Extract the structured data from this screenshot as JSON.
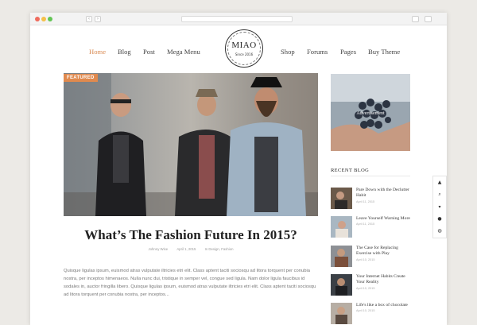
{
  "nav": {
    "home": "Home",
    "blog": "Blog",
    "post": "Post",
    "mega_menu": "Mega Menu",
    "shop": "Shop",
    "forums": "Forums",
    "pages": "Pages",
    "buy_theme": "Buy Theme"
  },
  "logo": {
    "title": "MIAO",
    "since": "Since 2016"
  },
  "featured": {
    "badge": "FEATURED",
    "title": "What’s The Fashion Future In 2015?",
    "meta_author": "Johnny Wise",
    "meta_date": "April 1, 2015",
    "meta_categories": "In Design, Fashion",
    "excerpt": "Quisque ligulas ipsum, euismod atras vulputate iltricies etri elit. Class aptent taciti sociosqu ad litora torquent per conubia nostra, per inceptos himenaeos. Nulla nunc dui, tristique in semper vel, congue sed ligula. Nam dolor ligula faucibus id sodales in, auctor fringilla libero. Quisque ligulas ipsum, euismod atras vulputate iltricies etri elit. Class aptent taciti sociosqu ad litora torquent per conubia nostra, per inceptos..."
  },
  "sidebar": {
    "ad_label": "Advertisement",
    "recent_title": "RECENT BLOG",
    "items": [
      {
        "title": "Pare Down with the Declutter Habit",
        "date": "April 11, 2015"
      },
      {
        "title": "Leave Yourself Warning More",
        "date": "April 11, 2015"
      },
      {
        "title": "The Case for Replacing Exercise with Play",
        "date": "April 10, 2015"
      },
      {
        "title": "Your Internet Habits Create Your Reality",
        "date": "April 10, 2015"
      },
      {
        "title": "Life's like a box of chocolate",
        "date": "April 10, 2015"
      }
    ]
  },
  "colors": {
    "accent": "#e08a4f",
    "nav_active": "#d98a52"
  },
  "tools": [
    "arrow-up-icon",
    "search-icon",
    "cart-icon",
    "user-icon",
    "globe-icon"
  ]
}
